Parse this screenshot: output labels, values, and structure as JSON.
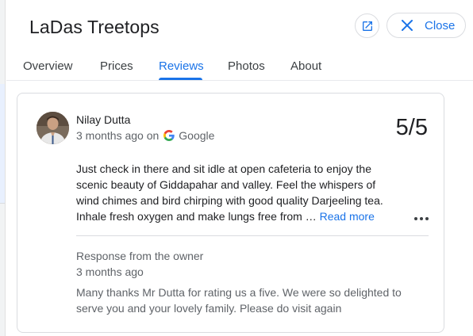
{
  "header": {
    "title": "LaDas Treetops",
    "close_label": "Close"
  },
  "tabs": [
    {
      "label": "Overview"
    },
    {
      "label": "Prices"
    },
    {
      "label": "Reviews"
    },
    {
      "label": "Photos"
    },
    {
      "label": "About"
    }
  ],
  "active_tab": "Reviews",
  "review": {
    "reviewer_name": "Nilay Dutta",
    "time": "3 months ago on",
    "source": "Google",
    "rating": "5/5",
    "text": "Just check in there and sit idle at open cafeteria to enjoy the scenic beauty of Giddapahar and valley. Feel the whispers of wind chimes and bird chirping with good quality Darjeeling tea. Inhale fresh oxygen and make lungs free from … ",
    "read_more": "Read more"
  },
  "owner_response": {
    "heading": "Response from the owner",
    "time": "3 months ago",
    "text": "Many thanks Mr Dutta for rating us a five. We were so delighted to serve you and your lovely family. Please do visit again"
  },
  "colors": {
    "accent": "#1a73e8",
    "text_primary": "#202124",
    "text_secondary": "#5f6368",
    "border": "#dadce0"
  },
  "icons": [
    "open-in-new-icon",
    "close-icon",
    "google-g-icon",
    "more-vert-icon",
    "avatar"
  ]
}
